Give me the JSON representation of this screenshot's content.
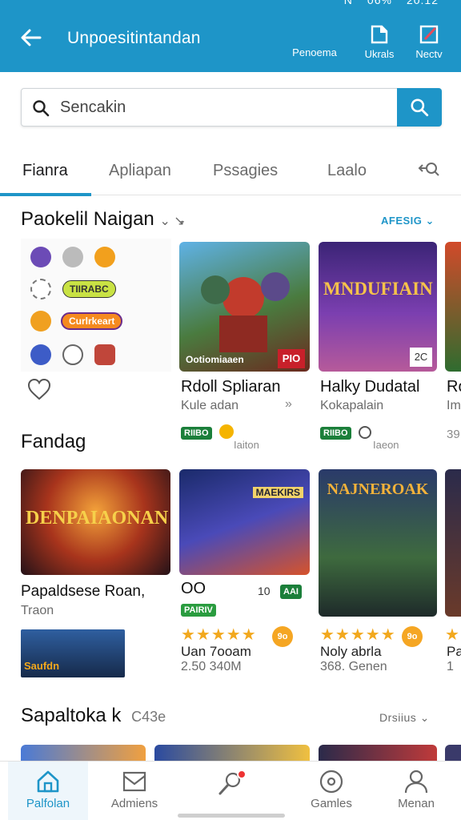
{
  "status": {
    "left": "N",
    "mid": "06%",
    "time": "20:12"
  },
  "appbar": {
    "title": "Unpoesitintandan",
    "actions": [
      {
        "label": "Penoema",
        "icon": "bookmark-icon"
      },
      {
        "label": "Ukrals",
        "icon": "document-icon"
      },
      {
        "label": "Nectv",
        "icon": "edit-icon"
      }
    ]
  },
  "search": {
    "placeholder": "Sencakin"
  },
  "tabs": [
    "Fianra",
    "Apliapan",
    "Pssagies",
    "Laalo"
  ],
  "section1": {
    "title": "Paokelil Naigan",
    "title_suffix": "⌄ ↘̵",
    "more": "AFESIG"
  },
  "icon_panel": {
    "pill1": "TIIRABC",
    "pill2": "Curlrkeart"
  },
  "row1": [
    {
      "title": "Rdoll Spliaran",
      "sub": "Kule adan",
      "badge": "RIIBO",
      "meta": "Iaiton",
      "img_text": "Ootiomiaaen",
      "img_badge": "PIO"
    },
    {
      "title": "Halky Dudatal",
      "sub": "Kokapalain",
      "badge": "RIIBO",
      "meta": "Iaeon",
      "img_text": "MNDUFIAIN",
      "img_badge": "2C"
    },
    {
      "title": "Ro",
      "sub": "Im",
      "badge": "",
      "meta": "39"
    }
  ],
  "section2": {
    "title": "Fandag"
  },
  "row2": [
    {
      "title": "Papaldsese Roan,",
      "sub": "Traon",
      "img_text": "DENPAIAONAN",
      "thumb_text": "Saufdn"
    },
    {
      "title": "Uan 7ooam",
      "sub": "2.50 340M",
      "img_text": "MAEKIRS",
      "pre": "OO",
      "count": "10",
      "chip": "AAI",
      "badge": "PAIRIV",
      "stars": "★★★★★",
      "rating": "9o"
    },
    {
      "title": "Noly abrla",
      "sub": "368. Genen",
      "img_text": "NAJNEROAK",
      "stars": "★★★★★",
      "rating": "9o"
    },
    {
      "title": "Pa",
      "sub": "1",
      "stars": "★"
    }
  ],
  "section3": {
    "title": "Sapaltoka k",
    "title_suffix": "C43e",
    "more": "Drsiius"
  },
  "nav": [
    {
      "label": "Palfolan",
      "icon": "home-icon"
    },
    {
      "label": "Admiens",
      "icon": "mail-icon"
    },
    {
      "label": "",
      "icon": "search-icon"
    },
    {
      "label": "Gamles",
      "icon": "disc-icon"
    },
    {
      "label": "Menan",
      "icon": "user-icon"
    }
  ],
  "colors": {
    "primary": "#1e95c8",
    "badge_green": "#1b7f3a",
    "star": "#f2a81d"
  }
}
